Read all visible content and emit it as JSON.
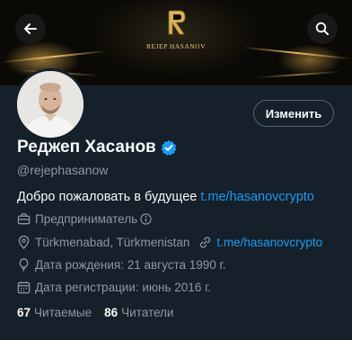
{
  "banner": {
    "logo_text": "REJEP HASANOV"
  },
  "header": {
    "back_icon": "back-arrow-icon",
    "search_icon": "search-icon"
  },
  "profile": {
    "edit_label": "Изменить",
    "name": "Реджеп Хасанов",
    "handle": "@rejephasanow",
    "bio_text": "Добро пожаловать в будущее ",
    "bio_link": "t.me/hasanovcrypto",
    "job": "Предприниматель",
    "location": "Türkmenabad, Türkmenistan",
    "website": "t.me/hasanovcrypto",
    "birth": "Дата рождения: 21 августа 1990 г.",
    "joined": "Дата регистрации: июнь 2016 г."
  },
  "stats": {
    "following_count": "67",
    "following_label": "Читаемые",
    "followers_count": "86",
    "followers_label": "Читатели"
  },
  "colors": {
    "background": "#15202b",
    "accent": "#1d9bf0",
    "muted": "#8b98a5",
    "gold": "#e7c977"
  }
}
